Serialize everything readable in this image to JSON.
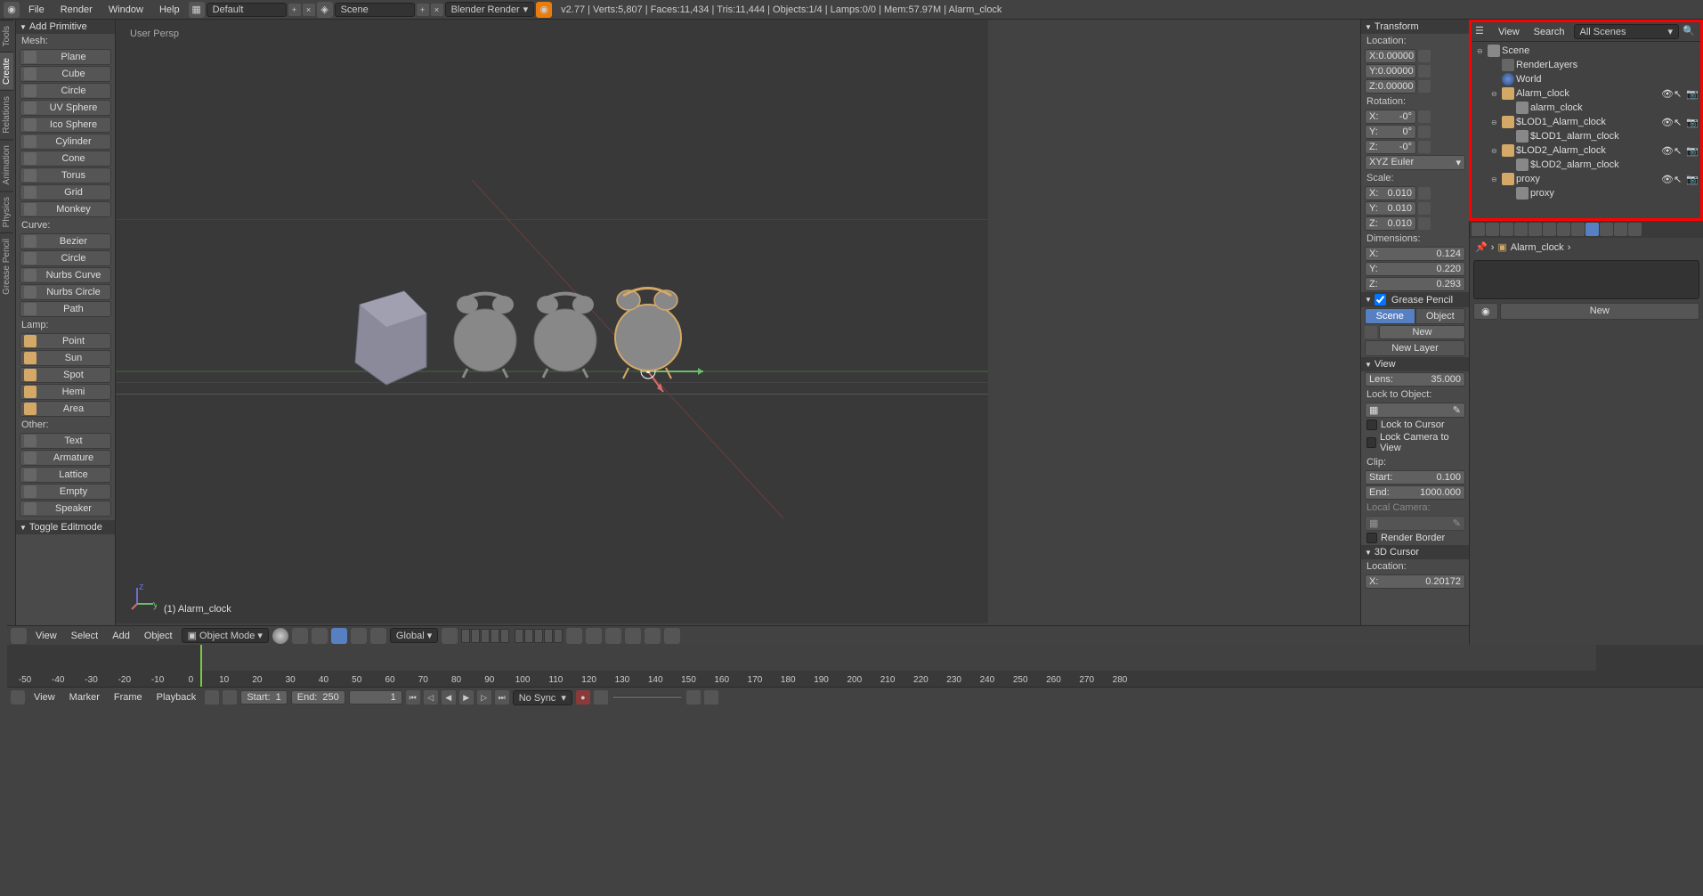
{
  "top_menu": {
    "items": [
      "File",
      "Render",
      "Window",
      "Help"
    ],
    "layout": "Default",
    "scene": "Scene",
    "renderer": "Blender Render",
    "stats": "v2.77 | Verts:5,807 | Faces:11,434 | Tris:11,444 | Objects:1/4 | Lamps:0/0 | Mem:57.97M | Alarm_clock"
  },
  "vtabs": [
    "Tools",
    "Create",
    "Relations",
    "Animation",
    "Physics",
    "Grease Pencil"
  ],
  "left_panel": {
    "header": "Add Primitive",
    "mesh_label": "Mesh:",
    "mesh": [
      "Plane",
      "Cube",
      "Circle",
      "UV Sphere",
      "Ico Sphere",
      "Cylinder",
      "Cone",
      "Torus",
      "Grid",
      "Monkey"
    ],
    "curve_label": "Curve:",
    "curve": [
      "Bezier",
      "Circle",
      "Nurbs Curve",
      "Nurbs Circle",
      "Path"
    ],
    "lamp_label": "Lamp:",
    "lamp": [
      "Point",
      "Sun",
      "Spot",
      "Hemi",
      "Area"
    ],
    "other_label": "Other:",
    "other": [
      "Text",
      "Armature",
      "Lattice",
      "Empty",
      "Speaker"
    ],
    "toggle": "Toggle Editmode"
  },
  "viewport": {
    "persp": "User Persp",
    "selected": "(1) Alarm_clock"
  },
  "n_panel": {
    "transform": "Transform",
    "location": "Location:",
    "loc": {
      "x": "0.00000",
      "y": "0.00000",
      "z": "0.00000"
    },
    "rotation": "Rotation:",
    "rot": {
      "x": "-0°",
      "y": "0°",
      "z": "-0°"
    },
    "rot_mode": "XYZ Euler",
    "scale": "Scale:",
    "scl": {
      "x": "0.010",
      "y": "0.010",
      "z": "0.010"
    },
    "dimensions": "Dimensions:",
    "dim": {
      "x": "0.124",
      "y": "0.220",
      "z": "0.293"
    },
    "grease": "Grease Pencil",
    "scene_btn": "Scene",
    "object_btn": "Object",
    "new": "New",
    "new_layer": "New Layer",
    "view": "View",
    "lens": "Lens:",
    "lens_val": "35.000",
    "lock_obj": "Lock to Object:",
    "lock_cursor": "Lock to Cursor",
    "lock_cam": "Lock Camera to View",
    "clip": "Clip:",
    "clip_start": "Start:",
    "clip_start_v": "0.100",
    "clip_end": "End:",
    "clip_end_v": "1000.000",
    "local_cam": "Local Camera:",
    "render_border": "Render Border",
    "cursor3d": "3D Cursor",
    "cursor_loc": "Location:",
    "cursor_x": "0.20172"
  },
  "outliner": {
    "view": "View",
    "search": "Search",
    "filter": "All Scenes",
    "tree": [
      {
        "lvl": 0,
        "exp": "⊖",
        "ico": "scene",
        "name": "Scene"
      },
      {
        "lvl": 1,
        "exp": "",
        "ico": "render",
        "name": "RenderLayers"
      },
      {
        "lvl": 1,
        "exp": "",
        "ico": "world",
        "name": "World"
      },
      {
        "lvl": 1,
        "exp": "⊖",
        "ico": "obj",
        "name": "Alarm_clock",
        "eyes": true
      },
      {
        "lvl": 2,
        "exp": "",
        "ico": "mesh",
        "name": "alarm_clock"
      },
      {
        "lvl": 1,
        "exp": "⊖",
        "ico": "obj",
        "name": "$LOD1_Alarm_clock",
        "eyes": true
      },
      {
        "lvl": 2,
        "exp": "",
        "ico": "mesh",
        "name": "$LOD1_alarm_clock"
      },
      {
        "lvl": 1,
        "exp": "⊖",
        "ico": "obj",
        "name": "$LOD2_Alarm_clock",
        "eyes": true
      },
      {
        "lvl": 2,
        "exp": "",
        "ico": "mesh",
        "name": "$LOD2_alarm_clock"
      },
      {
        "lvl": 1,
        "exp": "⊖",
        "ico": "obj",
        "name": "proxy",
        "eyes": true
      },
      {
        "lvl": 2,
        "exp": "",
        "ico": "mesh",
        "name": "proxy"
      }
    ]
  },
  "props": {
    "breadcrumb": "Alarm_clock",
    "new": "New"
  },
  "view3d_hdr": {
    "menus": [
      "View",
      "Select",
      "Add",
      "Object"
    ],
    "mode": "Object Mode",
    "orient": "Global"
  },
  "timeline": {
    "menus": [
      "View",
      "Marker",
      "Frame",
      "Playback"
    ],
    "start_l": "Start:",
    "start_v": "1",
    "end_l": "End:",
    "end_v": "250",
    "cur_v": "1",
    "sync": "No Sync",
    "ticks": [
      -50,
      -40,
      -30,
      -20,
      -10,
      0,
      10,
      20,
      30,
      40,
      50,
      60,
      70,
      80,
      90,
      100,
      110,
      120,
      130,
      140,
      150,
      160,
      170,
      180,
      190,
      200,
      210,
      220,
      230,
      240,
      250,
      260,
      270,
      280
    ]
  }
}
